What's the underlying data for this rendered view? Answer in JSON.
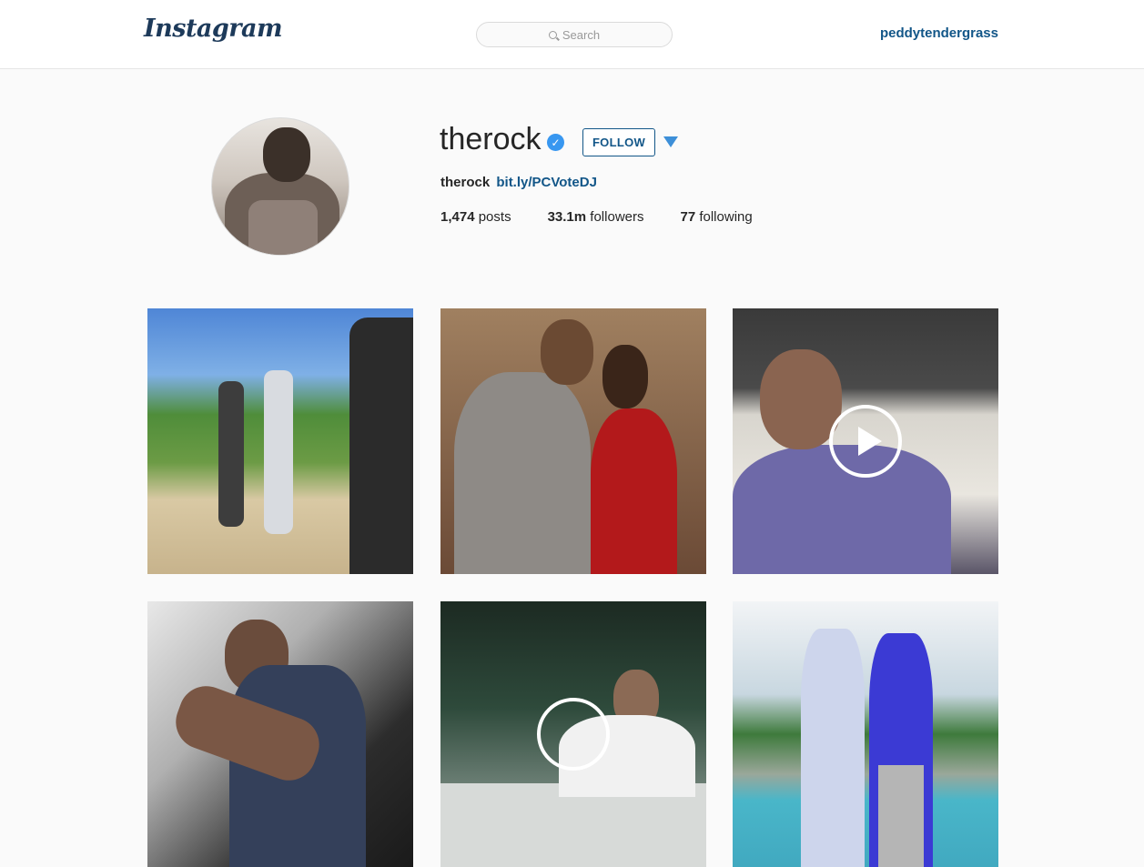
{
  "nav": {
    "logo": "Instagram",
    "search_placeholder": "Search",
    "current_user": "peddytendergrass"
  },
  "profile": {
    "username": "therock",
    "verified": true,
    "follow_label": "FOLLOW",
    "bio_name": "therock",
    "bio_link": "bit.ly/PCVoteDJ",
    "stats": [
      {
        "value": "1,474",
        "label": "posts"
      },
      {
        "value": "33.1m",
        "label": "followers"
      },
      {
        "value": "77",
        "label": "following"
      }
    ]
  },
  "posts": [
    {
      "type": "photo",
      "scene": "beach-film-set"
    },
    {
      "type": "photo",
      "scene": "red-carpet"
    },
    {
      "type": "video",
      "scene": "car-selfie"
    },
    {
      "type": "photo",
      "scene": "helicopter-pilot"
    },
    {
      "type": "video",
      "scene": "locker-room"
    },
    {
      "type": "photo",
      "scene": "poolside"
    }
  ],
  "colors": {
    "link": "#125688",
    "verified": "#3897f0",
    "background": "#fafafa"
  }
}
